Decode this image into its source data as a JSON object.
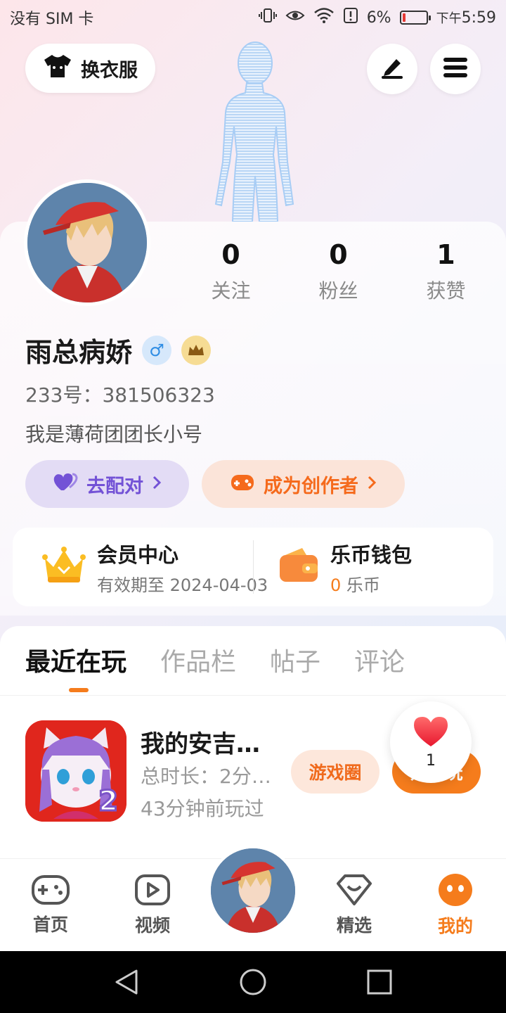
{
  "status_bar": {
    "carrier": "没有 SIM 卡",
    "battery": "6%",
    "time_prefix": "下午",
    "time": "5:59"
  },
  "top": {
    "outfit_label": "换衣服",
    "edit_icon": "edit-icon",
    "menu_icon": "menu-icon"
  },
  "profile": {
    "stats": [
      {
        "value": "0",
        "label": "关注"
      },
      {
        "value": "0",
        "label": "粉丝"
      },
      {
        "value": "1",
        "label": "获赞"
      }
    ],
    "username": "雨总病娇",
    "gender_symbol": "♂",
    "id_line": "233号：381506323",
    "bio": "我是薄荷团团长小号",
    "match_label": "去配对",
    "creator_label": "成为创作者"
  },
  "member": {
    "title": "会员中心",
    "subtitle": "有效期至 2024-04-03"
  },
  "wallet": {
    "title": "乐币钱包",
    "amount": "0",
    "unit": "乐币"
  },
  "tabs": [
    {
      "label": "最近在玩",
      "active": true
    },
    {
      "label": "作品栏",
      "active": false
    },
    {
      "label": "帖子",
      "active": false
    },
    {
      "label": "评论",
      "active": false
    }
  ],
  "game": {
    "title": "我的安吉…",
    "duration": "总时长：2分…",
    "last_played": "43分钟前玩过",
    "circle_button": "游戏圈",
    "play_button": "开始玩",
    "badge_number": "2"
  },
  "like_bubble": {
    "count": "1"
  },
  "bottom_nav": [
    {
      "label": "首页",
      "icon": "gamepad-icon",
      "active": false
    },
    {
      "label": "视频",
      "icon": "video-icon",
      "active": false
    },
    {
      "label": "精选",
      "icon": "heart-box-icon",
      "active": false
    },
    {
      "label": "我的",
      "icon": "face-icon",
      "active": true
    }
  ],
  "colors": {
    "accent": "#f57c1c",
    "match": "#7352d6"
  }
}
